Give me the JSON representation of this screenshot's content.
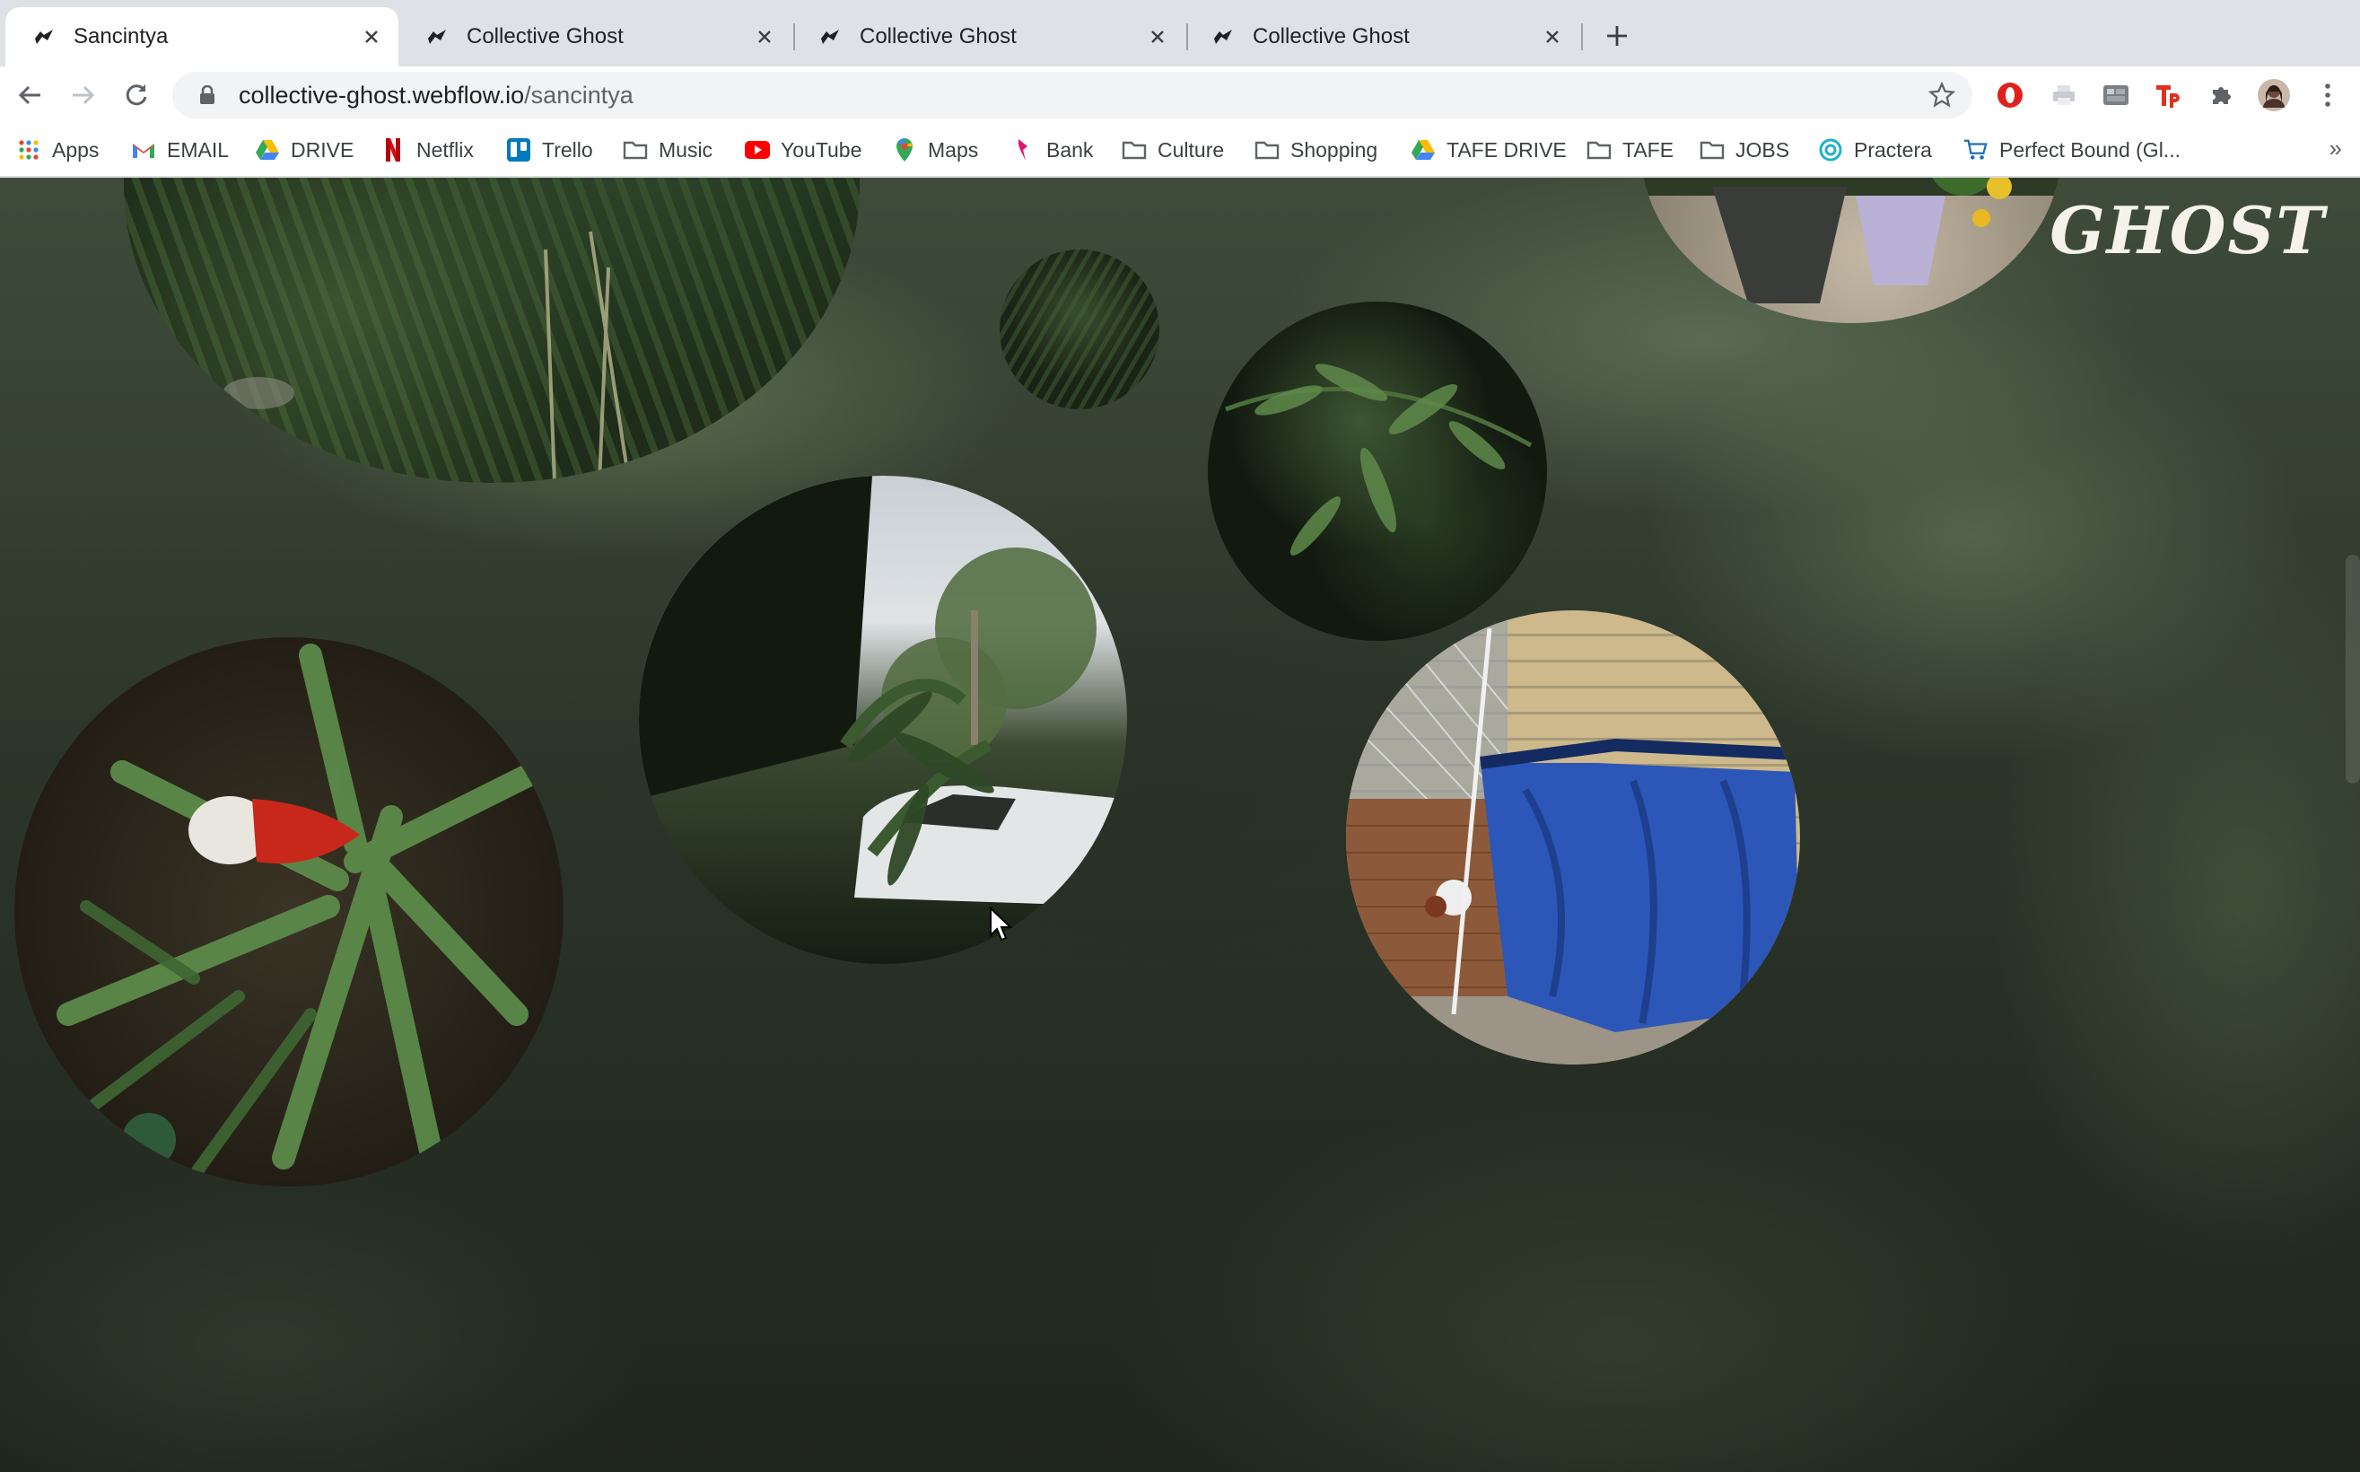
{
  "tabs": [
    {
      "title": "Sancintya",
      "active": true
    },
    {
      "title": "Collective Ghost",
      "active": false
    },
    {
      "title": "Collective Ghost",
      "active": false
    },
    {
      "title": "Collective Ghost",
      "active": false
    }
  ],
  "address_bar": {
    "host": "collective-ghost.webflow.io",
    "path": "/sancintya"
  },
  "bookmarks": [
    {
      "label": "Apps",
      "icon": "apps-grid-icon"
    },
    {
      "label": "EMAIL",
      "icon": "gmail-icon"
    },
    {
      "label": "DRIVE",
      "icon": "drive-icon"
    },
    {
      "label": "Netflix",
      "icon": "netflix-icon"
    },
    {
      "label": "Trello",
      "icon": "trello-icon"
    },
    {
      "label": "Music",
      "icon": "folder-icon"
    },
    {
      "label": "YouTube",
      "icon": "youtube-icon"
    },
    {
      "label": "Maps",
      "icon": "maps-icon"
    },
    {
      "label": "Bank",
      "icon": "bank-icon"
    },
    {
      "label": "Culture",
      "icon": "folder-icon"
    },
    {
      "label": "Shopping",
      "icon": "folder-icon"
    },
    {
      "label": "TAFE DRIVE",
      "icon": "drive-icon"
    },
    {
      "label": "TAFE",
      "icon": "folder-icon"
    },
    {
      "label": "JOBS",
      "icon": "folder-icon"
    },
    {
      "label": "Practera",
      "icon": "practera-icon"
    },
    {
      "label": "Perfect Bound (Gl...",
      "icon": "cart-icon"
    }
  ],
  "bookmarks_overflow": "»",
  "page": {
    "logo": "GHOST",
    "photos": [
      {
        "subject": "dark garden foliage"
      },
      {
        "subject": "small dark foliage"
      },
      {
        "subject": "potted plants"
      },
      {
        "subject": "leafy branches"
      },
      {
        "subject": "trees and white car"
      },
      {
        "subject": "garden ornament among spiky leaves"
      },
      {
        "subject": "blue tarp against brick wall"
      }
    ]
  },
  "colors": {
    "tab_strip": "#dee1e6",
    "toolbar": "#ffffff",
    "logo": "#f4f2ea",
    "tarp": "#2c56b8"
  }
}
